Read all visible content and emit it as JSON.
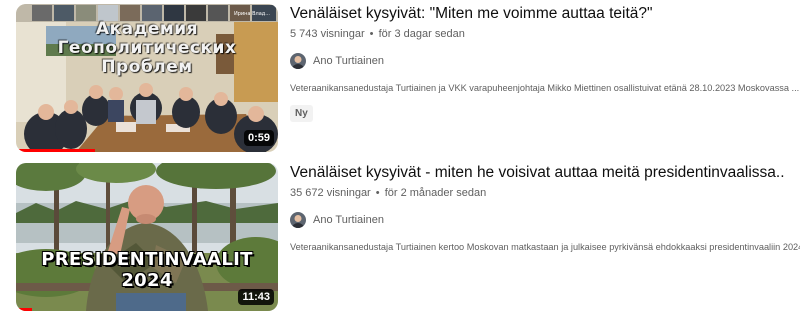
{
  "videos": [
    {
      "title": "Venäläiset kysyivät: \"Miten me voimme auttaa teitä?\"",
      "views": "5 743 visningar",
      "age": "för 3 dagar sedan",
      "channel": "Ano Turtiainen",
      "description": "Veteraanikansanedustaja Turtiainen ja VKK varapuheenjohtaja Mikko Miettinen osallistuivat etänä 28.10.2023 Moskovassa ...",
      "badge": "Ny",
      "duration": "0:59",
      "thumbnail_caption": [
        "Академия",
        "Геополитических",
        "Проблем"
      ],
      "thumbnail_name_tag": "Ирина Влад...",
      "watched_fraction": 0.3
    },
    {
      "title": "Venäläiset kysyivät - miten he voisivat auttaa meitä presidentinvaalissa..",
      "views": "35 672 visningar",
      "age": "för 2 månader sedan",
      "channel": "Ano Turtiainen",
      "description": "Veteraanikansanedustaja Turtiainen kertoo Moskovan matkastaan ja julkaisee pyrkivänsä ehdokkaaksi presidentinvaaliin 2024.",
      "duration": "11:43",
      "thumbnail_caption": [
        "PRESIDENTINVAALIT",
        "2024"
      ],
      "watched_fraction": 0.06
    }
  ],
  "colors": {
    "accent": "#ff0000",
    "secondary_text": "#606060",
    "title_text": "#0f0f0f",
    "badge_bg": "#f2f2f2"
  }
}
